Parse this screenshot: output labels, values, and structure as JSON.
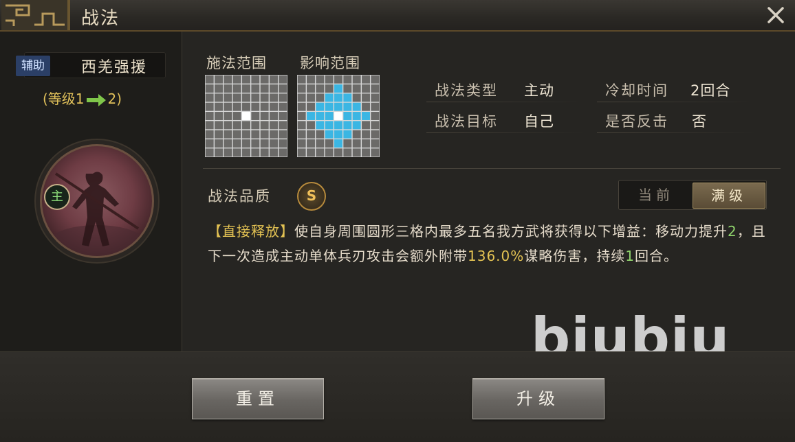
{
  "window": {
    "title": "战法"
  },
  "skill": {
    "type_tag": "辅助",
    "name": "西羌强援",
    "level_prefix": "(等级1",
    "level_suffix": "2)",
    "main_badge": "主",
    "portrait_icon": "warrior-portrait"
  },
  "grids": {
    "cast_range_label": "施法范围",
    "affect_range_label": "影响范围"
  },
  "attributes": [
    {
      "label": "战法类型",
      "value": "主动"
    },
    {
      "label": "冷却时间",
      "value": "2回合"
    },
    {
      "label": "战法目标",
      "value": "自己"
    },
    {
      "label": "是否反击",
      "value": "否"
    }
  ],
  "quality": {
    "label": "战法品质",
    "grade": "S"
  },
  "toggle": {
    "current": "当前",
    "max": "满级",
    "selected": "max"
  },
  "description": {
    "tag": "【直接释放】",
    "p1": "使自身周围圆形三格内最多五名我方武将获得以下增益：移动力提升",
    "v1": "2",
    "p2": "，且下一次造成主动单体兵刃攻击会额外附带",
    "v2": "136.0%",
    "p3": "谋略伤害，持续",
    "v3": "1",
    "p4": "回合。"
  },
  "watermark": "biubiu",
  "buttons": {
    "reset": "重置",
    "upgrade": "升级"
  },
  "colors": {
    "highlight": "#e3c253",
    "grid_highlight": "#3bb6e3",
    "grid_cell": "#6b6a68"
  }
}
